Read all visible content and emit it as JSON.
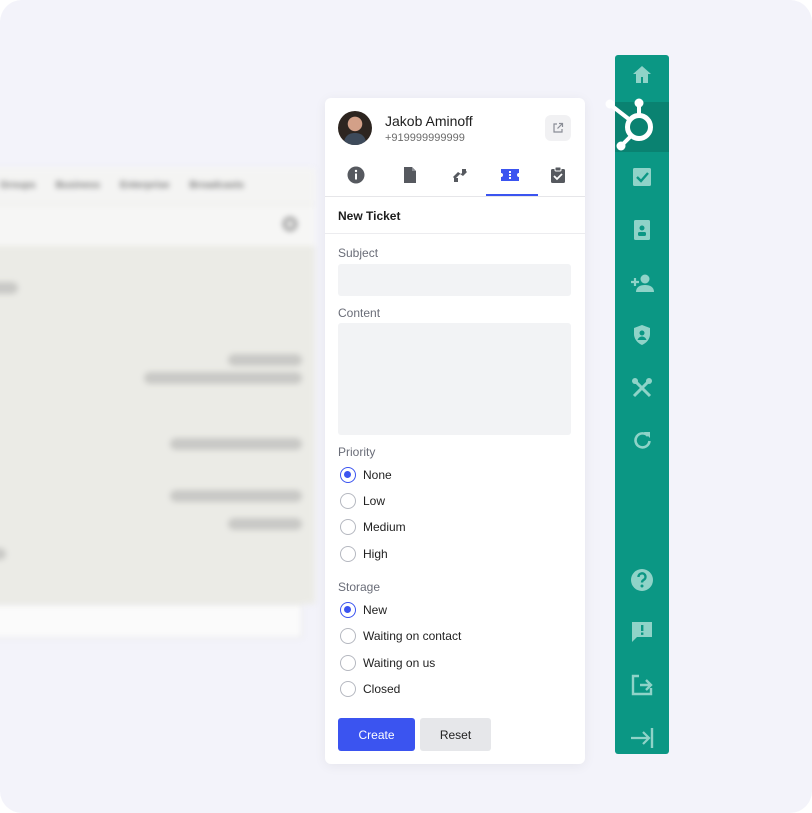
{
  "background_app": {
    "tabs": [
      "Groups",
      "Business",
      "Enterprise",
      "Broadcasts"
    ]
  },
  "contact": {
    "name": "Jakob Aminoff",
    "phone": "+919999999999"
  },
  "tabs": [
    {
      "icon": "info-icon"
    },
    {
      "icon": "document-icon"
    },
    {
      "icon": "deals-icon"
    },
    {
      "icon": "ticket-icon",
      "active": true
    },
    {
      "icon": "tasks-icon"
    }
  ],
  "form": {
    "title": "New Ticket",
    "subject_label": "Subject",
    "subject_value": "",
    "content_label": "Content",
    "content_value": "",
    "priority_label": "Priority",
    "priority_options": [
      "None",
      "Low",
      "Medium",
      "High"
    ],
    "priority_selected": "None",
    "storage_label": "Storage",
    "storage_options": [
      "New",
      "Waiting on contact",
      "Waiting on us",
      "Closed"
    ],
    "storage_selected": "New",
    "create_label": "Create",
    "reset_label": "Reset"
  },
  "sidebar": {
    "items": [
      "home-icon",
      "hubspot-icon",
      "checkbox-icon",
      "contacts-book-icon",
      "add-contact-icon",
      "shield-icon",
      "tools-icon",
      "refresh-icon",
      "help-icon",
      "feedback-icon",
      "logout-icon",
      "collapse-icon"
    ]
  },
  "colors": {
    "accent": "#3b54f0",
    "sidebar": "#0b9784",
    "hubspot_orange": "#ffffff"
  }
}
